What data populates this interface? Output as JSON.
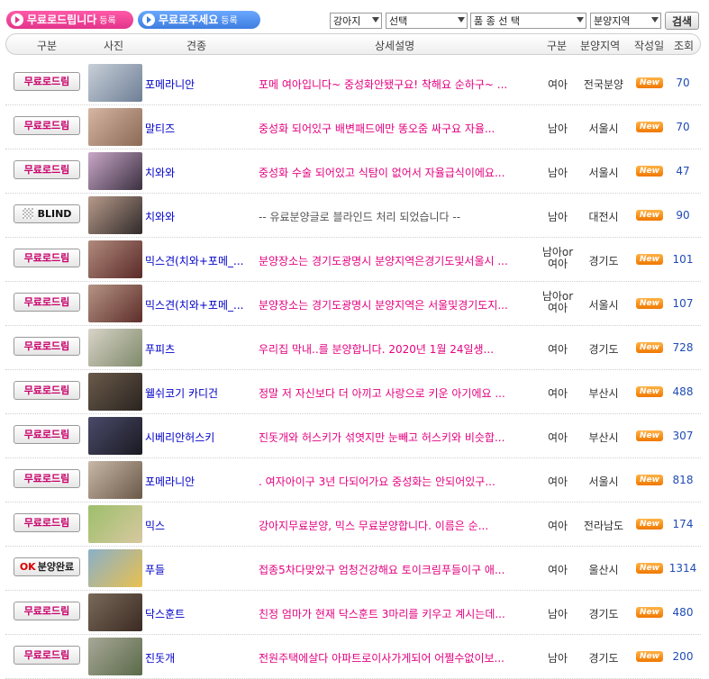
{
  "tabs": {
    "free_give": {
      "label": "무료로드립니다",
      "sub": "등록"
    },
    "free_want": {
      "label": "무료로주세요",
      "sub": "등록"
    }
  },
  "filters": {
    "animal": "강아지",
    "select": "선택",
    "breed": "품 종 선 택",
    "region": "분양지역",
    "search_label": "검색"
  },
  "columns": {
    "type": "구분",
    "photo": "사진",
    "breed": "견종",
    "detail": "상세설명",
    "gender": "구분",
    "region": "분양지역",
    "date": "작성일",
    "views": "조회"
  },
  "rows": [
    {
      "status": "무료로드림",
      "breed": "포메라니안",
      "desc": "포메 여아입니다~ 중성화안됐구요! 착해요 순하구~ ...",
      "gender": "여아",
      "region": "전국분양",
      "badge": "New",
      "views": "70",
      "thumb": [
        "#c8cfd8",
        "#6e7f96"
      ]
    },
    {
      "status": "무료로드림",
      "breed": "말티즈",
      "desc": "중성화 되어있구 배변패드에만 똥오줌 싸구요 자율...",
      "gender": "남아",
      "region": "서울시",
      "badge": "New",
      "views": "70",
      "thumb": [
        "#d6b6a2",
        "#8a6a56"
      ]
    },
    {
      "status": "무료로드림",
      "breed": "치와와",
      "desc": "중성화 수술 되어있고 식탐이 없어서 자율급식이에요...",
      "gender": "남아",
      "region": "서울시",
      "badge": "New",
      "views": "47",
      "thumb": [
        "#c9a7c8",
        "#3b3040"
      ]
    },
    {
      "status": "BLIND",
      "breed": "치와와",
      "desc": "-- 유료분양글로 블라인드 처리 되었습니다 --",
      "gender": "남아",
      "region": "대전시",
      "badge": "New",
      "views": "90",
      "thumb": [
        "#b89a8a",
        "#2f2a2a"
      ]
    },
    {
      "status": "무료로드림",
      "breed": "믹스견(치와+포메_...",
      "desc": "분양장소는 경기도광명시 분양지역은경기도및서울시 ...",
      "gender": "남아or 여아",
      "region": "경기도",
      "badge": "New",
      "views": "101",
      "thumb": [
        "#b08a7c",
        "#5a2a28"
      ]
    },
    {
      "status": "무료로드림",
      "breed": "믹스견(치와+포메_...",
      "desc": "분양장소는 경기도광명시 분양지역은 서울및경기도지...",
      "gender": "남아or 여아",
      "region": "서울시",
      "badge": "New",
      "views": "107",
      "thumb": [
        "#b59484",
        "#5e2e2a"
      ]
    },
    {
      "status": "무료로드림",
      "breed": "푸피츠",
      "desc": "우리집 막내..를 분양합니다. 2020년 1월 24일생...",
      "gender": "여아",
      "region": "경기도",
      "badge": "New",
      "views": "728",
      "thumb": [
        "#d9d3c8",
        "#7e8a6a"
      ]
    },
    {
      "status": "무료로드림",
      "breed": "웰쉬코기 카디건",
      "desc": "정말 저 자신보다 더 아끼고 사랑으로 키운 아기에요 ...",
      "gender": "여아",
      "region": "부산시",
      "badge": "New",
      "views": "488",
      "thumb": [
        "#6a5a4a",
        "#2a2420"
      ]
    },
    {
      "status": "무료로드림",
      "breed": "시베리안허스키",
      "desc": "진돗개와 허스키가 섞엿지만 눈빼고 허스키와 비슷합...",
      "gender": "여아",
      "region": "부산시",
      "badge": "New",
      "views": "307",
      "thumb": [
        "#4a4a6a",
        "#1a1a22"
      ]
    },
    {
      "status": "무료로드림",
      "breed": "포메라니안",
      "desc": ". 여자아이구 3년 다되어가요 중성화는 안되어있구...",
      "gender": "여아",
      "region": "서울시",
      "badge": "New",
      "views": "818",
      "thumb": [
        "#c8b8a8",
        "#6a5848"
      ]
    },
    {
      "status": "무료로드림",
      "breed": "믹스",
      "desc": "강아지무료분양, 믹스 무료분양합니다. 이름은 순...",
      "gender": "여아",
      "region": "전라남도",
      "badge": "New",
      "views": "174",
      "thumb": [
        "#9cbf6a",
        "#d8c8a0"
      ]
    },
    {
      "status": "분양완료",
      "breed": "푸들",
      "desc": "접종5차다맞았구 엄청건강해요 토이크림푸들이구 애...",
      "gender": "여아",
      "region": "울산시",
      "badge": "New",
      "views": "1314",
      "thumb": [
        "#8ab0c8",
        "#e8c050"
      ]
    },
    {
      "status": "무료로드림",
      "breed": "닥스훈트",
      "desc": "친정 엄마가 현재 닥스훈트 3마리를 키우고 계시는데...",
      "gender": "남아",
      "region": "경기도",
      "badge": "New",
      "views": "480",
      "thumb": [
        "#7a6a5a",
        "#3a2a22"
      ]
    },
    {
      "status": "무료로드림",
      "breed": "진돗개",
      "desc": "전원주택에살다 아파트로이사가게되어 어쩔수없이보...",
      "gender": "남아",
      "region": "경기도",
      "badge": "New",
      "views": "200",
      "thumb": [
        "#a8a898",
        "#5a6a48"
      ]
    }
  ]
}
